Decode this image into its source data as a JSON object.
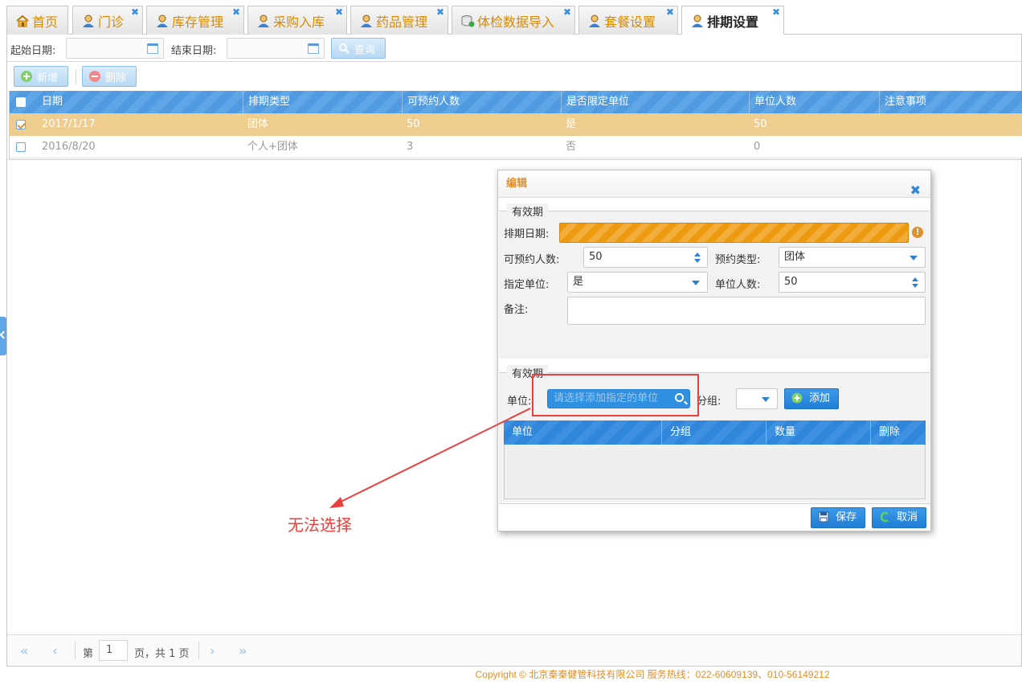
{
  "tabs": [
    {
      "label": "首页",
      "icon": "home-icon",
      "closable": false,
      "active": false
    },
    {
      "label": "门诊",
      "icon": "user-icon",
      "closable": true,
      "active": false
    },
    {
      "label": "库存管理",
      "icon": "user-icon",
      "closable": true,
      "active": false
    },
    {
      "label": "采购入库",
      "icon": "user-icon",
      "closable": true,
      "active": false
    },
    {
      "label": "药品管理",
      "icon": "user-icon",
      "closable": true,
      "active": false
    },
    {
      "label": "体检数据导入",
      "icon": "database-icon",
      "closable": true,
      "active": false
    },
    {
      "label": "套餐设置",
      "icon": "user-icon",
      "closable": true,
      "active": false
    },
    {
      "label": "排期设置",
      "icon": "user-icon",
      "closable": true,
      "active": true
    }
  ],
  "query": {
    "start_label": "起始日期:",
    "end_label": "结束日期:",
    "search_label": "查询"
  },
  "toolbar": {
    "add_label": "新增",
    "delete_label": "删除"
  },
  "grid": {
    "columns": [
      "日期",
      "排期类型",
      "可预约人数",
      "是否限定单位",
      "单位人数",
      "注意事项"
    ],
    "rows": [
      {
        "checked": true,
        "selected": true,
        "cells": [
          "2017/1/17",
          "团体",
          "50",
          "是",
          "50",
          ""
        ]
      },
      {
        "checked": false,
        "selected": false,
        "cells": [
          "2016/8/20",
          "个人+团体",
          "3",
          "否",
          "0",
          ""
        ]
      }
    ]
  },
  "pager": {
    "page_prefix": "第",
    "page_value": "1",
    "page_suffix": "页，共 1 页"
  },
  "footer": {
    "text": "Copyright © 北京秦秦健管科技有限公司 服务热线：022-60609139、010-56149212"
  },
  "dialog": {
    "title": "编辑",
    "section1_legend": "有效期",
    "schedule_date_label": "排期日期:",
    "bookable_label": "可预约人数:",
    "bookable_value": "50",
    "booking_type_label": "预约类型:",
    "booking_type_value": "团体",
    "designated_unit_label": "指定单位:",
    "designated_unit_value": "是",
    "unit_count_label": "单位人数:",
    "unit_count_value": "50",
    "remark_label": "备注:",
    "section2_legend": "有效期",
    "unit_label": "单位:",
    "unit_placeholder": "请选择添加指定的单位",
    "group_label": "分组:",
    "add_label": "添加",
    "unit_columns": [
      "单位",
      "分组",
      "数量",
      "删除"
    ],
    "save_label": "保存",
    "cancel_label": "取消"
  },
  "annotation": {
    "text": "无法选择"
  },
  "colors": {
    "accent_blue": "#2f8fe0",
    "header_blue": "#5fa6e6",
    "selected_row": "#efcd8e",
    "warning_orange": "#ec9a10",
    "annotation_red": "#e8403f",
    "tab_text": "#d98b00"
  }
}
